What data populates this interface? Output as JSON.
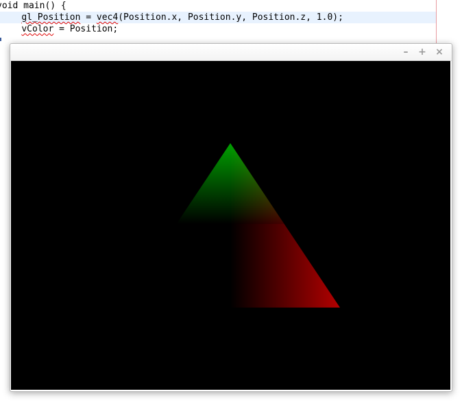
{
  "editor": {
    "lines": [
      "void main() {",
      "    gl_Position = vec4(Position.x, Position.y, Position.z, 1.0);",
      "    vColor = Position;"
    ],
    "line2": {
      "indent": "    ",
      "ident": "gl_Position",
      "mid": " = ",
      "fn": "vec4",
      "rest": "(Position.x, Position.y, Position.z, 1.0);"
    },
    "line3": {
      "indent": "    ",
      "ident": "vColor",
      "rest": " = Position;"
    }
  },
  "window": {
    "controls": {
      "minimize": "–",
      "maximize": "+",
      "close": "×"
    },
    "canvas_background": "#000000",
    "colors": {
      "green": "#00a000",
      "red": "#b30000"
    }
  }
}
